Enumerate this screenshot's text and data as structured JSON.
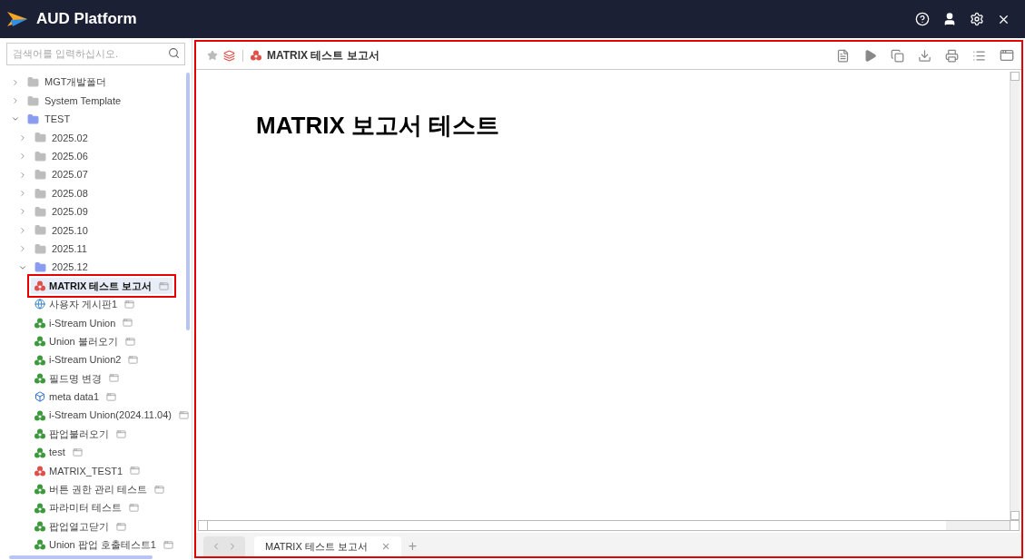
{
  "header": {
    "title": "AUD Platform"
  },
  "sidebar": {
    "search": {
      "placeholder": "검색어를 입력하십시오."
    },
    "tree": [
      {
        "kind": "folder",
        "label": "MGT개발폴더",
        "expanded": false,
        "selected": false
      },
      {
        "kind": "folder",
        "label": "System Template",
        "expanded": false,
        "selected": false
      },
      {
        "kind": "folder",
        "label": "TEST",
        "expanded": true,
        "selected": false,
        "children": [
          {
            "kind": "folder",
            "label": "2025.02",
            "expanded": false,
            "selected": false
          },
          {
            "kind": "folder",
            "label": "2025.06",
            "expanded": false,
            "selected": false
          },
          {
            "kind": "folder",
            "label": "2025.07",
            "expanded": false,
            "selected": false
          },
          {
            "kind": "folder",
            "label": "2025.08",
            "expanded": false,
            "selected": false
          },
          {
            "kind": "folder",
            "label": "2025.09",
            "expanded": false,
            "selected": false
          },
          {
            "kind": "folder",
            "label": "2025.10",
            "expanded": false,
            "selected": false
          },
          {
            "kind": "folder",
            "label": "2025.11",
            "expanded": false,
            "selected": false
          },
          {
            "kind": "folder",
            "label": "2025.12",
            "expanded": true,
            "selected": false,
            "children": [
              {
                "kind": "matrix",
                "label": "MATRIX 테스트 보고서",
                "selected": true
              },
              {
                "kind": "web",
                "label": "사용자 게시판1",
                "selected": false
              },
              {
                "kind": "stream",
                "label": "i-Stream Union",
                "selected": false
              },
              {
                "kind": "stream",
                "label": "Union 불러오기",
                "selected": false
              },
              {
                "kind": "stream",
                "label": "i-Stream Union2",
                "selected": false
              },
              {
                "kind": "stream",
                "label": "필드명 변경",
                "selected": false
              },
              {
                "kind": "meta",
                "label": "meta data1",
                "selected": false
              },
              {
                "kind": "stream",
                "label": "i-Stream Union(2024.11.04)",
                "selected": false
              },
              {
                "kind": "stream",
                "label": "팝업불러오기",
                "selected": false
              },
              {
                "kind": "stream",
                "label": "test",
                "selected": false
              },
              {
                "kind": "matrix",
                "label": "MATRIX_TEST1",
                "selected": false
              },
              {
                "kind": "stream",
                "label": "버튼 권한 관리 테스트",
                "selected": false
              },
              {
                "kind": "stream",
                "label": "파라미터 테스트",
                "selected": false
              },
              {
                "kind": "stream",
                "label": "팝업열고닫기",
                "selected": false
              },
              {
                "kind": "stream",
                "label": "Union 팝업 호출테스트1",
                "selected": false
              }
            ]
          }
        ]
      }
    ]
  },
  "report": {
    "title": "MATRIX 테스트 보고서",
    "heading": "MATRIX 보고서 테스트"
  },
  "tabs": [
    {
      "label": "MATRIX 테스트 보고서",
      "selected": true,
      "close": "×"
    }
  ],
  "add_tab": "+"
}
